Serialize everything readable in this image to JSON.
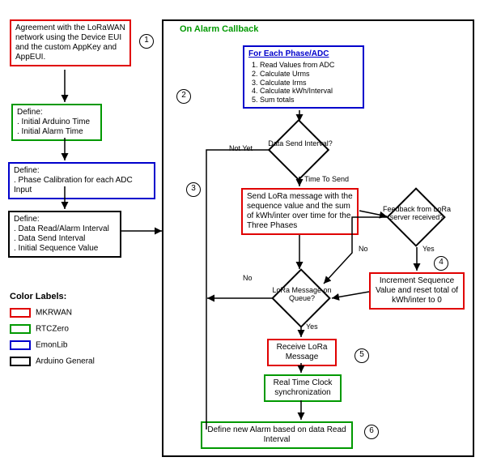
{
  "left": {
    "agreement": "Agreement with the LoRaWAN network using the Device EUI and the custom AppKey and AppEUI.",
    "define1_head": "Define:",
    "define1_a": ". Initial Arduino Time",
    "define1_b": ". Initial Alarm Time",
    "define2_head": "Define:",
    "define2_a": ". Phase Calibration for each ADC Input",
    "define3_head": "Define:",
    "define3_a": ". Data Read/Alarm Interval",
    "define3_b": ". Data Send Interval",
    "define3_c": ". Initial Sequence Value"
  },
  "legend": {
    "title": "Color Labels:",
    "mkrwan": "MKRWAN",
    "rtczero": "RTCZero",
    "emonlib": "EmonLib",
    "arduino": "Arduino General"
  },
  "callback": {
    "title": "On Alarm Callback",
    "foreach_head": "For Each Phase/ADC",
    "foreach_1": "Read Values from ADC",
    "foreach_2": "Calculate Urms",
    "foreach_3": "Calculate Irms",
    "foreach_4": "Calculate kWh/Interval",
    "foreach_5": "Sum totals",
    "d1": "Data Send Interval?",
    "d1_no": "Not Yet",
    "d1_yes": "Time To Send",
    "sendlora": "Send LoRa message with the sequence value and the sum of kWh/inter over time for the Three Phases",
    "d2": "Feedback from LoRa server received?",
    "d2_no": "No",
    "d2_yes": "Yes",
    "increment": "Increment Sequence Value and reset total of kWh/inter to 0",
    "d3": "LoRa Message on Queue?",
    "d3_no": "No",
    "d3_yes": "Yes",
    "receive": "Receive LoRa Message",
    "rtc": "Real Time Clock synchronization",
    "newalarm": "Define new Alarm based on data Read Interval"
  },
  "nums": {
    "n1": "1",
    "n2": "2",
    "n3": "3",
    "n4": "4",
    "n5": "5",
    "n6": "6"
  }
}
